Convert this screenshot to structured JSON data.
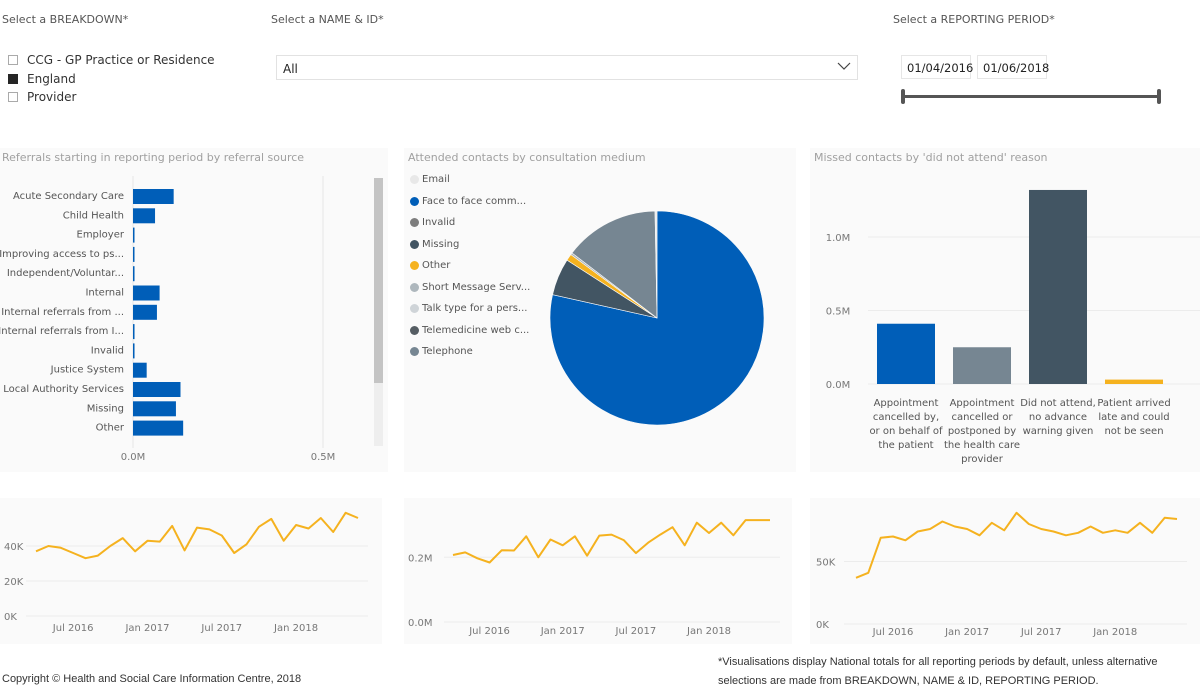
{
  "breakdown": {
    "title": "Select a BREAKDOWN*",
    "options": [
      {
        "label": "CCG - GP Practice or Residence",
        "checked": false
      },
      {
        "label": "England",
        "checked": true
      },
      {
        "label": "Provider",
        "checked": false
      }
    ]
  },
  "name_id": {
    "title": "Select a NAME & ID*",
    "selected": "All"
  },
  "reporting_period": {
    "title": "Select a REPORTING PERIOD*",
    "start": "01/04/2016",
    "end": "01/06/2018",
    "slider_range": [
      0,
      1
    ]
  },
  "colors": {
    "blue": "#005eb8",
    "yellow": "#f5b21f",
    "slate": "#425563",
    "grey": "#768692",
    "midgrey": "#7d7d7d"
  },
  "chart_data": [
    {
      "type": "bar",
      "orientation": "horizontal",
      "title": "Referrals starting in reporting period by referral source",
      "categories": [
        "Acute Secondary Care",
        "Child Health",
        "Employer",
        "Improving access to ps...",
        "Independent/Voluntar...",
        "Internal",
        "Internal referrals from ...",
        "Internal referrals from I...",
        "Invalid",
        "Justice System",
        "Local Authority Services",
        "Missing",
        "Other"
      ],
      "values": [
        107000,
        58000,
        3000,
        2000,
        4000,
        70000,
        63000,
        4000,
        4000,
        36000,
        125000,
        113000,
        132000
      ],
      "xticks": [
        "0.0M",
        "0.5M"
      ],
      "xlim": [
        0,
        600000
      ],
      "color": "#005eb8",
      "scrollable": true
    },
    {
      "type": "pie",
      "title": "Attended contacts by consultation medium",
      "legend": "left",
      "slices": [
        {
          "label": "Email",
          "short": "Email",
          "value": 0.3,
          "color": "#e8e8e8"
        },
        {
          "label": "Face to face comm...",
          "short": "Face to face comm...",
          "value": 78.5,
          "color": "#005eb8"
        },
        {
          "label": "Invalid",
          "short": "Invalid",
          "value": 0.0,
          "color": "#7d7d7d"
        },
        {
          "label": "Missing",
          "short": "Missing",
          "value": 5.6,
          "color": "#425563"
        },
        {
          "label": "Other",
          "short": "Other",
          "value": 1.0,
          "color": "#f5b21f"
        },
        {
          "label": "Short Message Serv...",
          "short": "Short Message Serv...",
          "value": 0.3,
          "color": "#aeb7bd"
        },
        {
          "label": "Talk type for a pers...",
          "short": "Talk type for a pers...",
          "value": 0.0,
          "color": "#cfd4d8"
        },
        {
          "label": "Telemedicine web c...",
          "short": "Telemedicine web c...",
          "value": 0.0,
          "color": "#555d63"
        },
        {
          "label": "Telephone",
          "short": "Telephone",
          "value": 14.3,
          "color": "#768692"
        }
      ],
      "unit": "percent"
    },
    {
      "type": "bar",
      "title": "Missed contacts by 'did not attend' reason",
      "categories": [
        [
          "Appointment",
          "cancelled by,",
          "or on behalf of",
          "the patient"
        ],
        [
          "Appointment",
          "cancelled or",
          "postponed by",
          "the health care",
          "provider"
        ],
        [
          "Did not attend,",
          "no advance",
          "warning given"
        ],
        [
          "Patient arrived",
          "late and could",
          "not be seen"
        ]
      ],
      "values": [
        410000,
        250000,
        1320000,
        30000
      ],
      "colors": [
        "#005eb8",
        "#768692",
        "#425563",
        "#f5b21f"
      ],
      "yticks": [
        "0.0M",
        "0.5M",
        "1.0M"
      ],
      "ylim": [
        0,
        1400000
      ]
    },
    {
      "type": "line",
      "title": "",
      "x": [
        "2016-04",
        "2016-05",
        "2016-06",
        "2016-07",
        "2016-08",
        "2016-09",
        "2016-10",
        "2016-11",
        "2016-12",
        "2017-01",
        "2017-02",
        "2017-03",
        "2017-04",
        "2017-05",
        "2017-06",
        "2017-07",
        "2017-08",
        "2017-09",
        "2017-10",
        "2017-11",
        "2017-12",
        "2018-01",
        "2018-02",
        "2018-03",
        "2018-04",
        "2018-05",
        "2018-06"
      ],
      "values": [
        37000,
        40000,
        39000,
        36000,
        33000,
        34500,
        40000,
        44500,
        37000,
        43000,
        42500,
        51500,
        37500,
        50500,
        49500,
        46000,
        36000,
        41000,
        51000,
        55500,
        43000,
        52000,
        50000,
        56000,
        48000,
        59000,
        56000
      ],
      "xticks": [
        "Jul 2016",
        "Jan 2017",
        "Jul 2017",
        "Jan 2018"
      ],
      "yticks": [
        "0K",
        "20K",
        "40K"
      ],
      "ylim": [
        0,
        60000
      ],
      "color": "#f5b21f"
    },
    {
      "type": "line",
      "title": "",
      "x": [
        "2016-04",
        "2016-05",
        "2016-06",
        "2016-07",
        "2016-08",
        "2016-09",
        "2016-10",
        "2016-11",
        "2016-12",
        "2017-01",
        "2017-02",
        "2017-03",
        "2017-04",
        "2017-05",
        "2017-06",
        "2017-07",
        "2017-08",
        "2017-09",
        "2017-10",
        "2017-11",
        "2017-12",
        "2018-01",
        "2018-02",
        "2018-03",
        "2018-04",
        "2018-05",
        "2018-06"
      ],
      "values": [
        207000,
        215000,
        197000,
        184000,
        222000,
        221000,
        265000,
        200000,
        255000,
        237000,
        265000,
        205000,
        267000,
        270000,
        253000,
        213000,
        245000,
        270000,
        293000,
        237000,
        307000,
        275000,
        307000,
        268000,
        315000,
        315000,
        315000
      ],
      "xticks": [
        "Jul 2016",
        "Jan 2017",
        "Jul 2017",
        "Jan 2018"
      ],
      "yticks": [
        "0.0M",
        "0.2M"
      ],
      "ylim": [
        0,
        340000
      ],
      "color": "#f5b21f"
    },
    {
      "type": "line",
      "title": "",
      "x": [
        "2016-04",
        "2016-05",
        "2016-06",
        "2016-07",
        "2016-08",
        "2016-09",
        "2016-10",
        "2016-11",
        "2016-12",
        "2017-01",
        "2017-02",
        "2017-03",
        "2017-04",
        "2017-05",
        "2017-06",
        "2017-07",
        "2017-08",
        "2017-09",
        "2017-10",
        "2017-11",
        "2017-12",
        "2018-01",
        "2018-02",
        "2018-03",
        "2018-04",
        "2018-05",
        "2018-06"
      ],
      "values": [
        37000,
        41000,
        69000,
        70000,
        67000,
        74000,
        76000,
        82000,
        78000,
        76000,
        71000,
        81000,
        75000,
        89000,
        80000,
        76000,
        74000,
        71000,
        73000,
        78000,
        73000,
        75000,
        73000,
        81000,
        73000,
        85000,
        84000
      ],
      "xticks": [
        "Jul 2016",
        "Jan 2017",
        "Jul 2017",
        "Jan 2018"
      ],
      "yticks": [
        "0K",
        "50K"
      ],
      "ylim": [
        0,
        100000
      ],
      "color": "#f5b21f"
    }
  ],
  "footer": {
    "copyright": "Copyright © Health and Social Care Information Centre, 2018",
    "note_line1": "*Visualisations display National totals for all reporting periods by default, unless alternative",
    "note_line2": "selections are made from BREAKDOWN, NAME & ID, REPORTING PERIOD."
  }
}
